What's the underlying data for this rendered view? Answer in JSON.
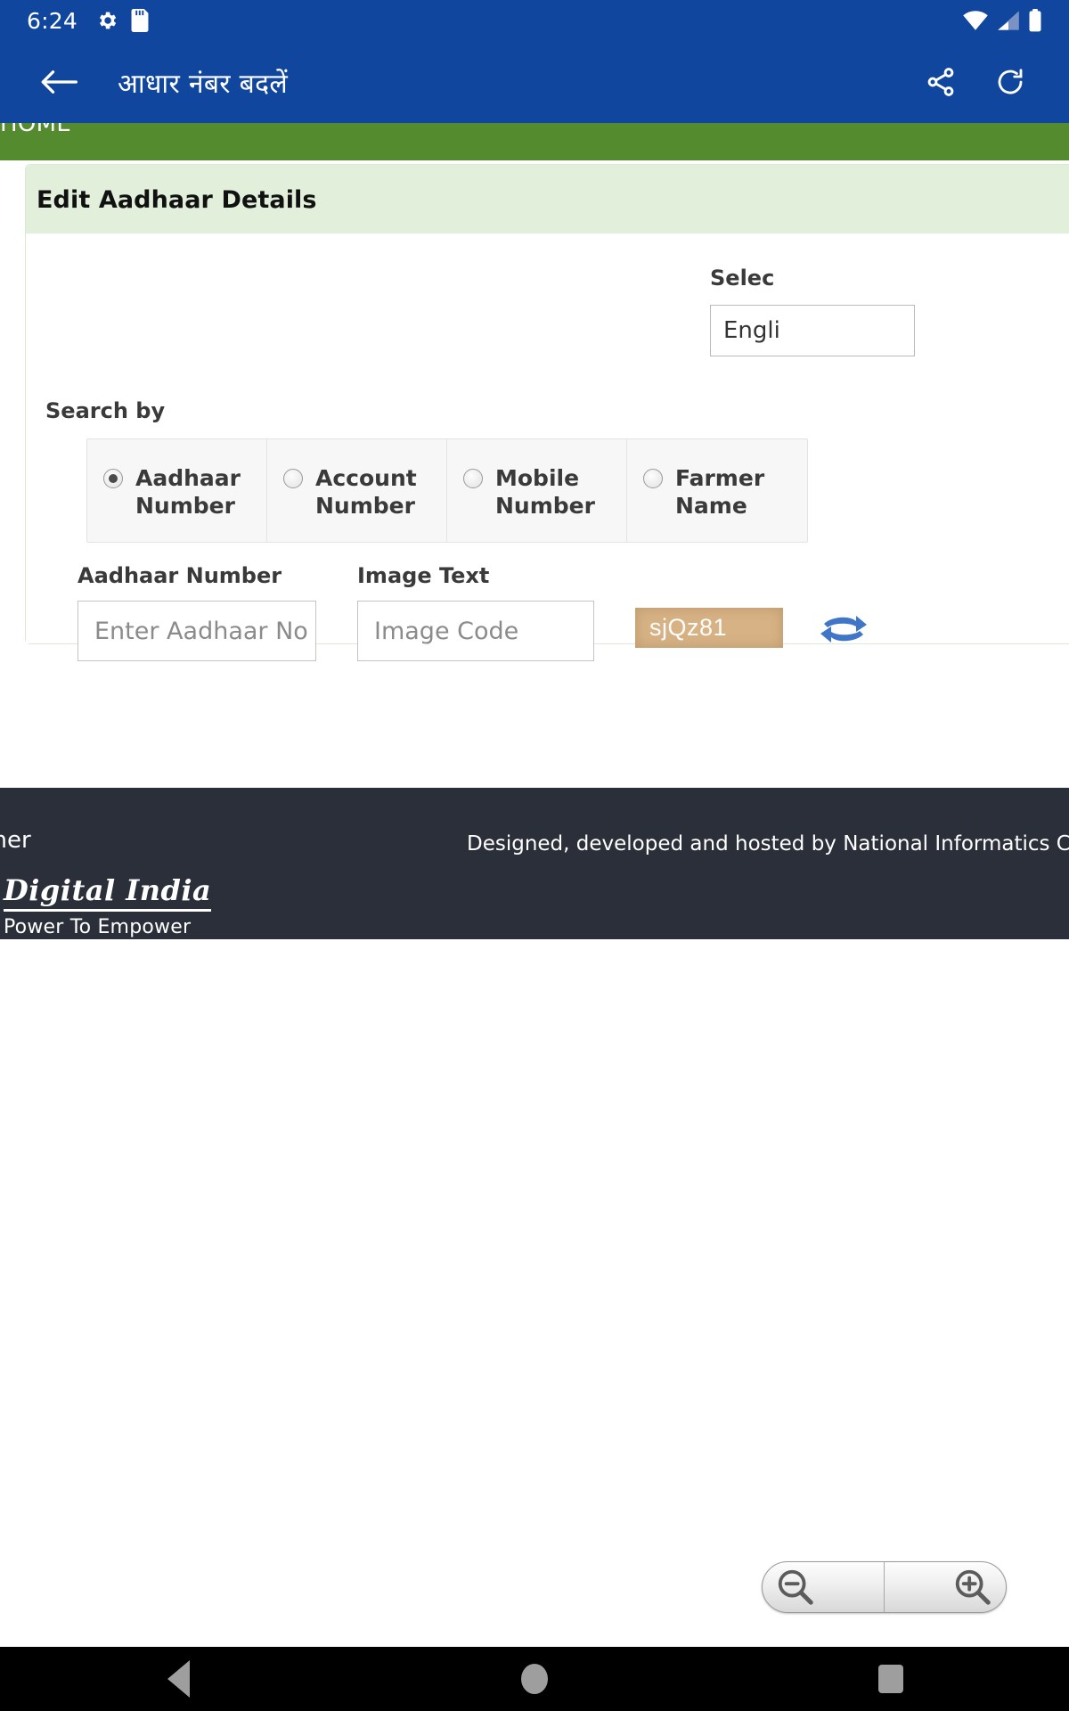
{
  "statusbar": {
    "time": "6:24",
    "icons": [
      "gear-icon",
      "sd-card-icon",
      "wifi-icon",
      "cellular-signal-icon",
      "battery-icon"
    ]
  },
  "appbar": {
    "title": "आधार नंबर बदलें",
    "back_icon": "back-arrow-icon",
    "share_icon": "share-icon",
    "refresh_icon": "refresh-icon"
  },
  "navstrip": {
    "home_label": "HOME"
  },
  "card": {
    "heading": "Edit Aadhaar Details",
    "language": {
      "label": "Selec",
      "value": "Engli"
    },
    "search_by": {
      "label": "Search by",
      "options": [
        {
          "label": "Aadhaar Number",
          "selected": true
        },
        {
          "label": "Account Number",
          "selected": false
        },
        {
          "label": "Mobile Number",
          "selected": false
        },
        {
          "label": "Farmer Name",
          "selected": false
        }
      ]
    },
    "fields": [
      {
        "label": "Aadhaar Number",
        "value": "",
        "placeholder": "Enter Aadhaar No"
      },
      {
        "label": "Image Text",
        "value": "",
        "placeholder": "Image Code"
      }
    ],
    "captcha": {
      "text": "sjQz81",
      "background_color": "#d6b285",
      "refresh_icon": "refresh-captcha-icon"
    }
  },
  "footer": {
    "disclaimer": "claimer",
    "credit": "Designed, developed and hosted by National Informatics Centre",
    "logo_line1": "Digital India",
    "logo_line2": "Power To Empower"
  },
  "zoom_controls": {
    "zoom_out_icon": "zoom-out-icon",
    "zoom_in_icon": "zoom-in-icon"
  },
  "navbar": {
    "back": "nav-back-icon",
    "home": "nav-home-icon",
    "recents": "nav-recents-icon"
  },
  "colors": {
    "appbar_blue": "#10469e",
    "nav_green": "#558b2f",
    "card_head_green": "#e2efda",
    "footer_dark": "#2b2f3a"
  }
}
